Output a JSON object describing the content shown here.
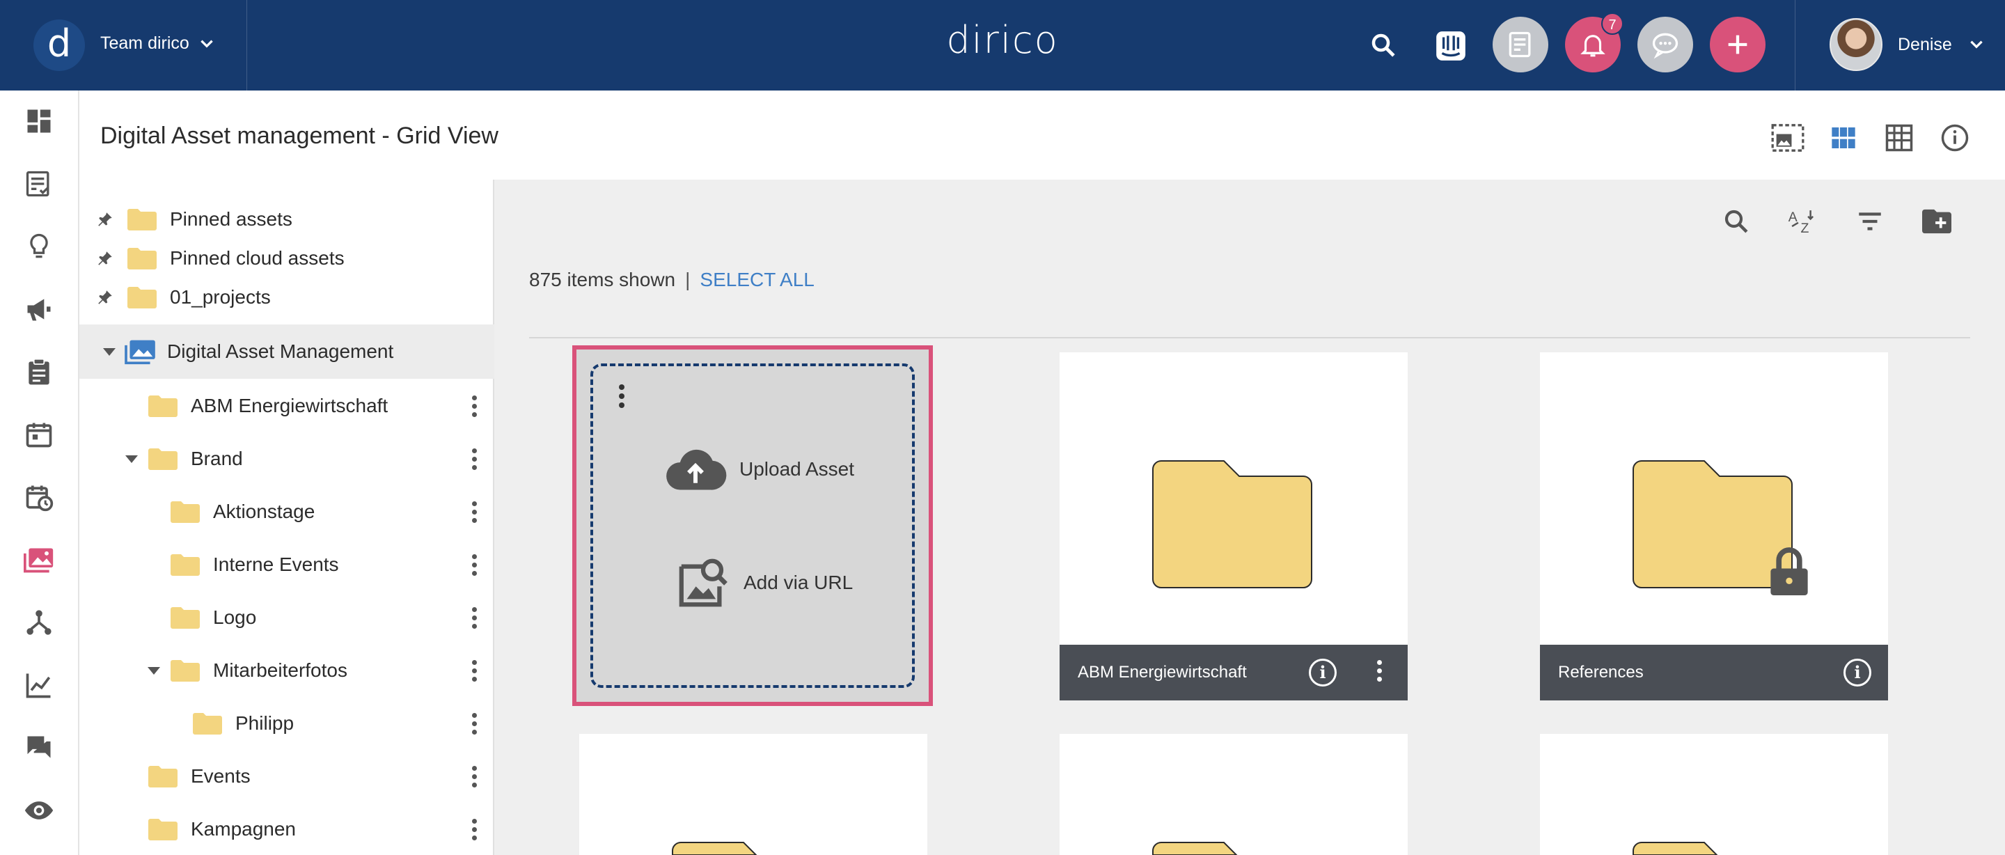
{
  "topbar": {
    "logo_letter": "d",
    "team_name": "Team dirico",
    "brand": "dirico",
    "notifications_count": "7",
    "user_name": "Denise",
    "colors": {
      "bar": "#163a6e",
      "accent": "#d9527a"
    }
  },
  "rail": {
    "items": [
      "dashboard-icon",
      "tasks-icon",
      "ideas-icon",
      "campaigns-icon",
      "briefings-icon",
      "calendar-icon",
      "schedule-icon",
      "assets-icon",
      "workflow-icon",
      "analytics-icon",
      "chat-icon",
      "review-icon"
    ],
    "active": "assets-icon"
  },
  "header": {
    "title": "Digital Asset management - Grid View"
  },
  "tree": {
    "pinned": [
      {
        "label": "Pinned assets"
      },
      {
        "label": "Pinned cloud assets"
      },
      {
        "label": "01_projects"
      }
    ],
    "root": {
      "label": "Digital Asset Management"
    },
    "items": [
      {
        "label": "ABM Energiewirtschaft",
        "level": 1,
        "caret": false
      },
      {
        "label": "Brand",
        "level": 1,
        "caret": true
      },
      {
        "label": "Aktionstage",
        "level": 2,
        "caret": false
      },
      {
        "label": "Interne Events",
        "level": 2,
        "caret": false
      },
      {
        "label": "Logo",
        "level": 2,
        "caret": false
      },
      {
        "label": "Mitarbeiterfotos",
        "level": 2,
        "caret": true
      },
      {
        "label": "Philipp",
        "level": 3,
        "caret": false
      },
      {
        "label": "Events",
        "level": 1,
        "caret": false
      },
      {
        "label": "Kampagnen",
        "level": 1,
        "caret": false
      }
    ]
  },
  "main": {
    "count_text": "875 items shown",
    "separator": "|",
    "select_all": "SELECT ALL",
    "upload_label": "Upload Asset",
    "url_label": "Add via URL",
    "cards": [
      {
        "label": "ABM Energiewirtschaft",
        "locked": false
      },
      {
        "label": "References",
        "locked": true
      }
    ]
  }
}
